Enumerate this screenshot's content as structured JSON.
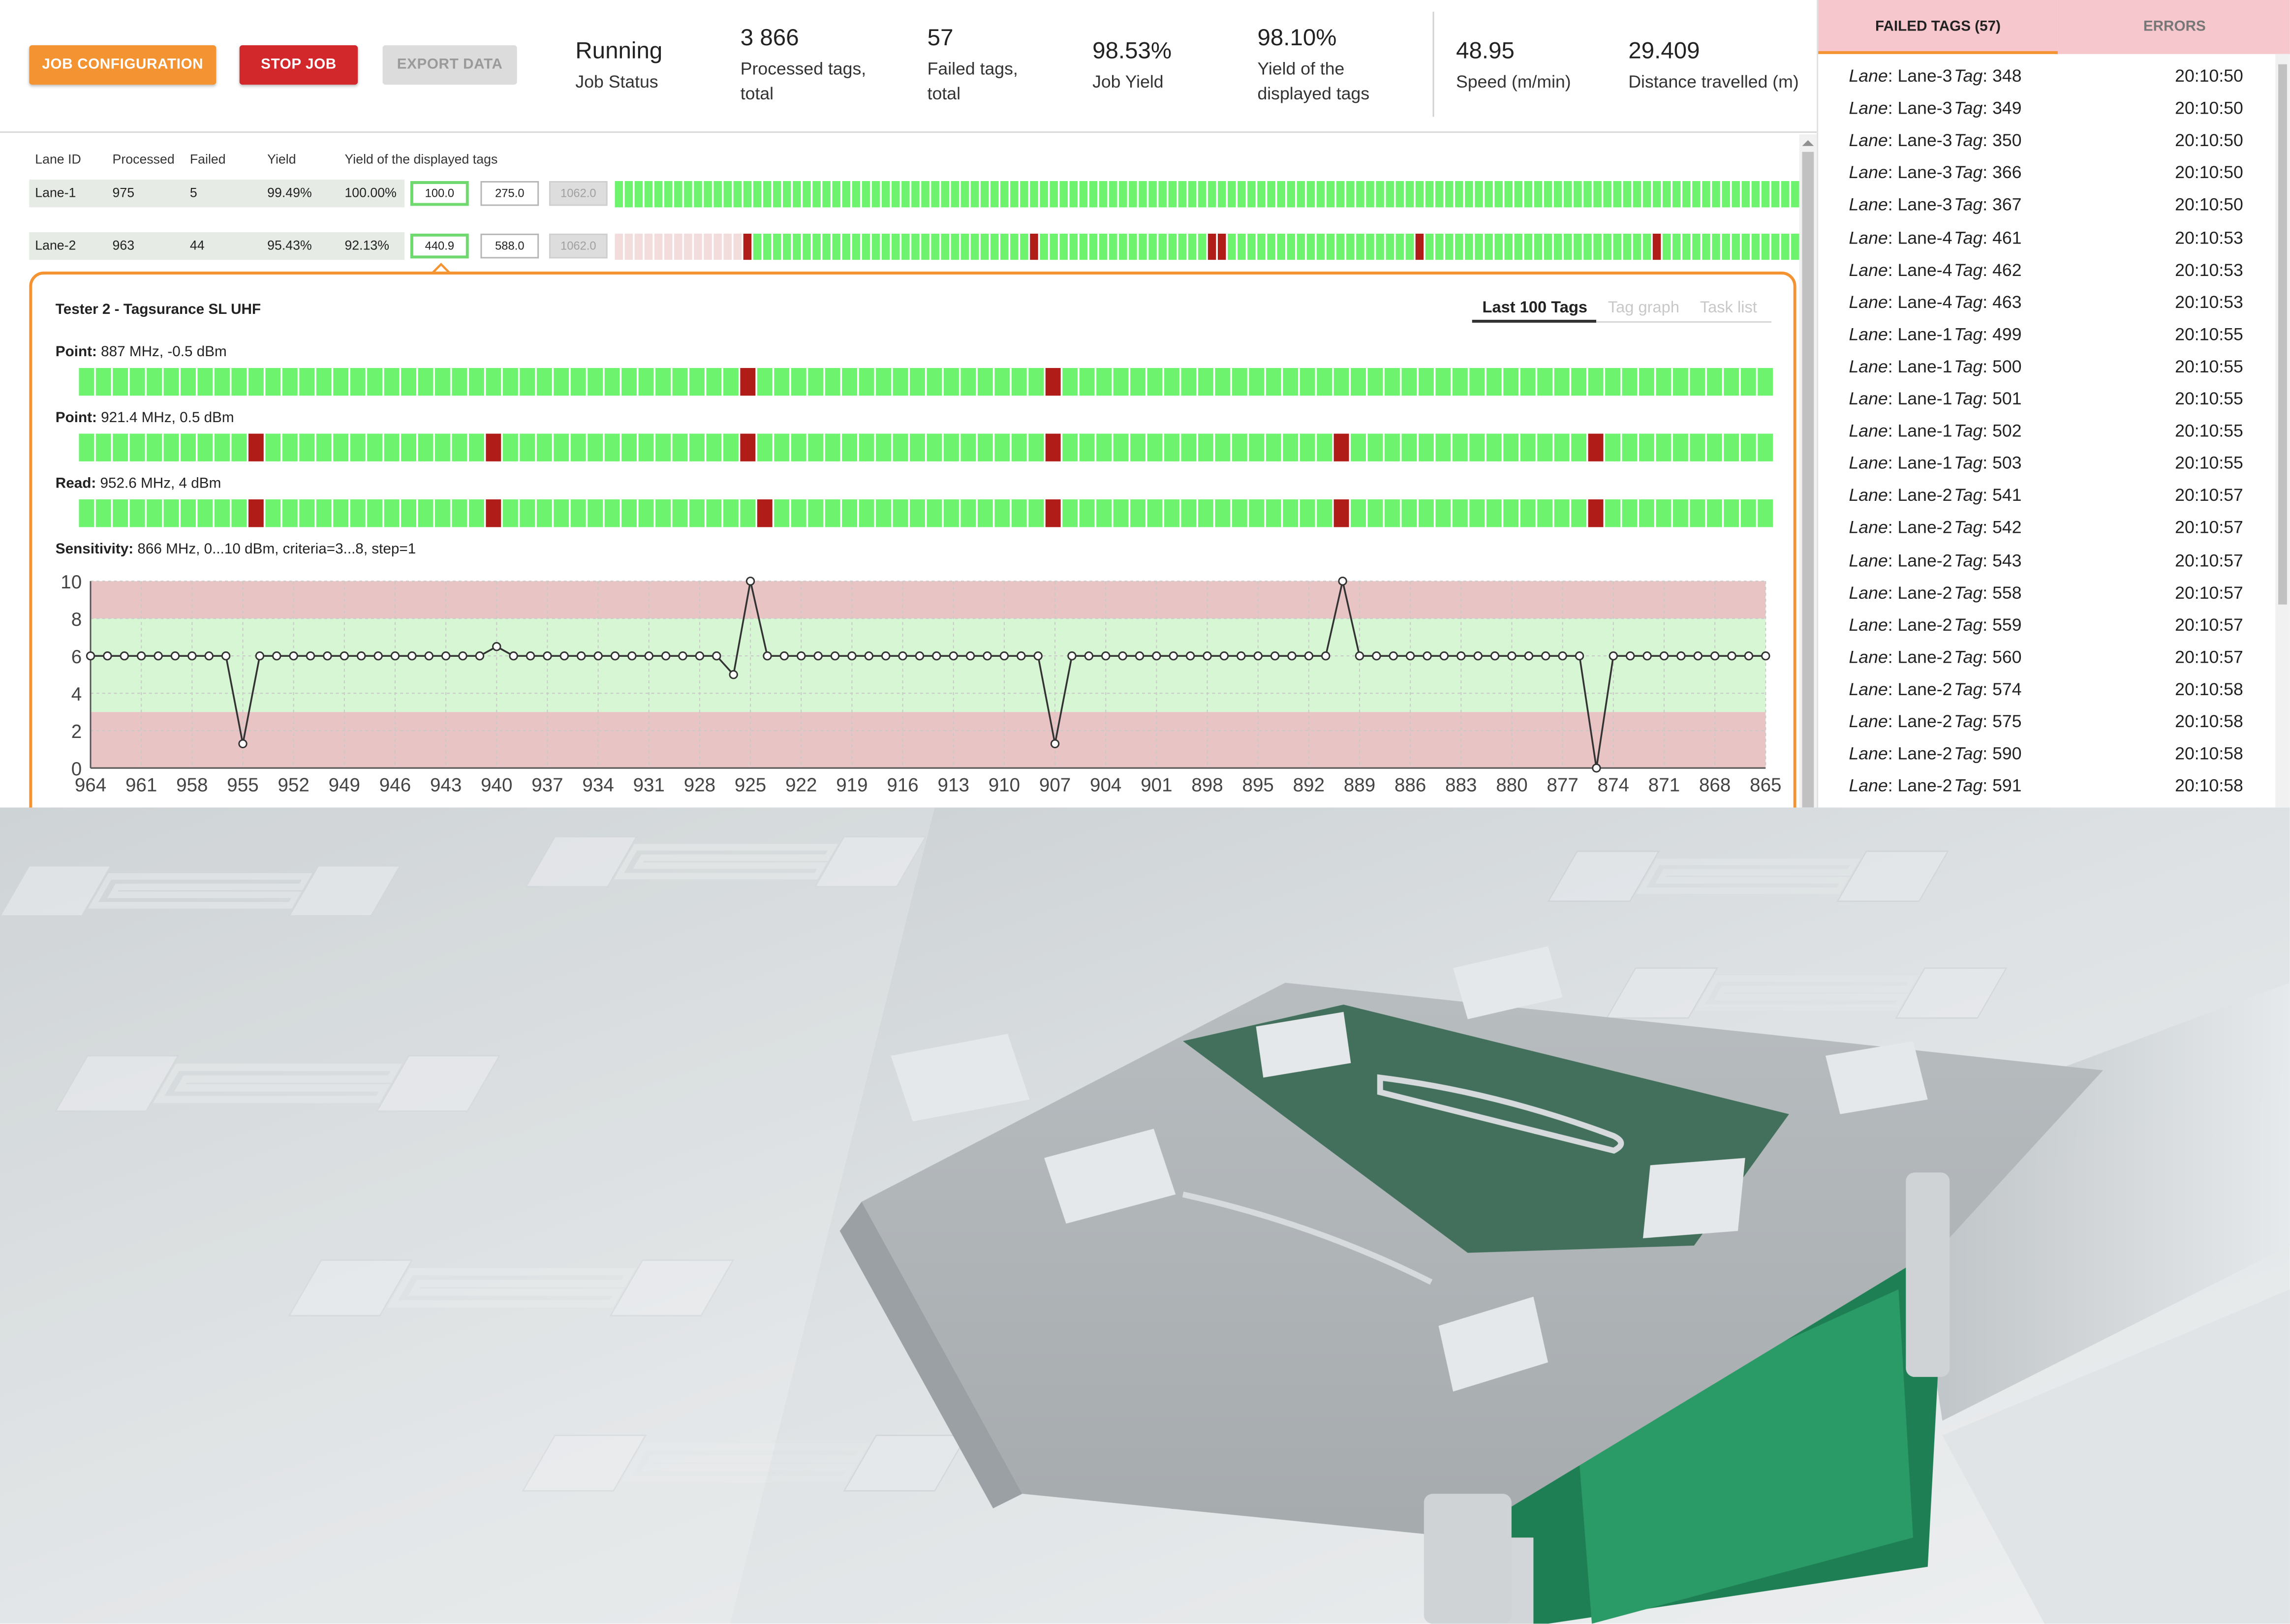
{
  "header": {
    "buttons": {
      "job_configuration": "JOB CONFIGURATION",
      "stop_job": "STOP JOB",
      "export_data": "EXPORT DATA"
    },
    "stats": [
      {
        "value": "Running",
        "label": "Job Status"
      },
      {
        "value": "3 866",
        "label": "Processed tags, total"
      },
      {
        "value": "57",
        "label": "Failed tags, total"
      },
      {
        "value": "98.53%",
        "label": "Job Yield"
      },
      {
        "value": "98.10%",
        "label": "Yield of the displayed tags"
      },
      {
        "value": "48.95",
        "label": "Speed (m/min)"
      },
      {
        "value": "29.409",
        "label": "Distance travelled (m)"
      }
    ]
  },
  "lanes": {
    "columns": [
      "Lane ID",
      "Processed",
      "Failed",
      "Yield",
      "Yield of the displayed tags"
    ],
    "rows": [
      {
        "id": "Lane-1",
        "processed": "975",
        "failed": "5",
        "yield": "99.49%",
        "displayed_yield": "100.00%",
        "inputs": [
          "100.0",
          "275.0",
          "1062.0"
        ],
        "fail_positions": []
      },
      {
        "id": "Lane-2",
        "processed": "963",
        "failed": "44",
        "yield": "95.43%",
        "displayed_yield": "92.13%",
        "inputs": [
          "440.9",
          "588.0",
          "1062.0"
        ],
        "fail_positions": [
          0.1052,
          0.3493,
          0.3559,
          0.5034,
          0.5102,
          0.6842,
          0.8808
        ]
      }
    ]
  },
  "tester": {
    "title": "Tester 2 - Tagsurance SL UHF",
    "tabs": [
      "Last 100 Tags",
      "Tag graph",
      "Task list"
    ],
    "active_tab": "Last 100 Tags",
    "strips": [
      {
        "name": "Point:",
        "detail": " 887 MHz, -0.5 dBm",
        "fail_positions": [
          0.392,
          0.573
        ]
      },
      {
        "name": "Point:",
        "detail": " 921.4 MHz, 0.5 dBm",
        "fail_positions": [
          0.103,
          0.244,
          0.392,
          0.573,
          0.744,
          0.898
        ]
      },
      {
        "name": "Read:",
        "detail": " 952.6 MHz, 4 dBm",
        "fail_positions": [
          0.103,
          0.244,
          0.401,
          0.573,
          0.744,
          0.898
        ]
      }
    ],
    "sensitivity": {
      "name": "Sensitivity:",
      "detail": " 866 MHz, 0...10 dBm, criteria=3...8, step=1"
    }
  },
  "chart_data": {
    "type": "line",
    "title": "Sensitivity: 866 MHz, 0...10 dBm, criteria=3...8, step=1",
    "ylim": [
      0,
      10
    ],
    "yticks": [
      0,
      2,
      4,
      6,
      8,
      10
    ],
    "xticks": [
      964,
      961,
      958,
      955,
      952,
      949,
      946,
      943,
      940,
      937,
      934,
      931,
      928,
      925,
      922,
      919,
      916,
      913,
      910,
      907,
      904,
      901,
      898,
      895,
      892,
      889,
      886,
      883,
      880,
      877,
      874,
      871,
      868,
      865
    ],
    "x_start": 964,
    "x_end": 865,
    "criteria_band": [
      3,
      8
    ],
    "baseline": 6,
    "exceptions": [
      {
        "x": 955,
        "y": 1.3
      },
      {
        "x": 940,
        "y": 6.5
      },
      {
        "x": 926,
        "y": 5
      },
      {
        "x": 925,
        "y": 10
      },
      {
        "x": 907,
        "y": 1.3
      },
      {
        "x": 890,
        "y": 10
      },
      {
        "x": 875,
        "y": 0
      }
    ],
    "colors": {
      "line": "#333333",
      "fail_band": "#e8c4c4",
      "pass_band": "#d7f6d3",
      "pass_bar": "#6ef36e",
      "fail_bar": "#b01c18"
    }
  },
  "right_panel": {
    "tabs": [
      "FAILED TAGS (57)",
      "ERRORS"
    ],
    "lane_label": "Lane",
    "tag_label": "Tag",
    "failed_tags": [
      {
        "lane": "Lane-3",
        "tag": "348",
        "time": "20:10:50"
      },
      {
        "lane": "Lane-3",
        "tag": "349",
        "time": "20:10:50"
      },
      {
        "lane": "Lane-3",
        "tag": "350",
        "time": "20:10:50"
      },
      {
        "lane": "Lane-3",
        "tag": "366",
        "time": "20:10:50"
      },
      {
        "lane": "Lane-3",
        "tag": "367",
        "time": "20:10:50"
      },
      {
        "lane": "Lane-4",
        "tag": "461",
        "time": "20:10:53"
      },
      {
        "lane": "Lane-4",
        "tag": "462",
        "time": "20:10:53"
      },
      {
        "lane": "Lane-4",
        "tag": "463",
        "time": "20:10:53"
      },
      {
        "lane": "Lane-1",
        "tag": "499",
        "time": "20:10:55"
      },
      {
        "lane": "Lane-1",
        "tag": "500",
        "time": "20:10:55"
      },
      {
        "lane": "Lane-1",
        "tag": "501",
        "time": "20:10:55"
      },
      {
        "lane": "Lane-1",
        "tag": "502",
        "time": "20:10:55"
      },
      {
        "lane": "Lane-1",
        "tag": "503",
        "time": "20:10:55"
      },
      {
        "lane": "Lane-2",
        "tag": "541",
        "time": "20:10:57"
      },
      {
        "lane": "Lane-2",
        "tag": "542",
        "time": "20:10:57"
      },
      {
        "lane": "Lane-2",
        "tag": "543",
        "time": "20:10:57"
      },
      {
        "lane": "Lane-2",
        "tag": "558",
        "time": "20:10:57"
      },
      {
        "lane": "Lane-2",
        "tag": "559",
        "time": "20:10:57"
      },
      {
        "lane": "Lane-2",
        "tag": "560",
        "time": "20:10:57"
      },
      {
        "lane": "Lane-2",
        "tag": "574",
        "time": "20:10:58"
      },
      {
        "lane": "Lane-2",
        "tag": "575",
        "time": "20:10:58"
      },
      {
        "lane": "Lane-2",
        "tag": "590",
        "time": "20:10:58"
      },
      {
        "lane": "Lane-2",
        "tag": "591",
        "time": "20:10:58"
      }
    ]
  }
}
